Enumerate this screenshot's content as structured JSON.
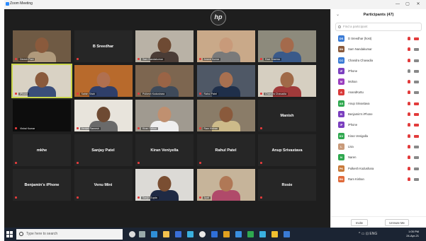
{
  "window": {
    "title": "Zoom Meeting",
    "minimize": "—",
    "maximize": "▢",
    "close": "✕"
  },
  "gallery": {
    "overlay_logo": "hp",
    "tiles": [
      {
        "label": "Dinesh Pani",
        "kind": "video",
        "bg": "#6f5a44",
        "skin": "#8a5a3c",
        "shirt": "#b09a7c"
      },
      {
        "label": "",
        "name": "B Sreedhar",
        "kind": "name"
      },
      {
        "label": "Sam Nandakumar",
        "kind": "video",
        "bg": "#b9b2a6",
        "skin": "#6e4a33",
        "shirt": "#4a3c36"
      },
      {
        "label": "Anand Kumar",
        "kind": "video",
        "bg": "#c9a989",
        "skin": "#c89a7a",
        "shirt": "#7a7a7a"
      },
      {
        "label": "Ravi Sharma",
        "kind": "video",
        "bg": "#8d8a7c",
        "skin": "#a46a4c",
        "shirt": "#3a5a8a"
      },
      {
        "label": "iPhone",
        "kind": "video",
        "bg": "#d9d2c4",
        "skin": "#8a5a3c",
        "shirt": "#3b4e7a"
      },
      {
        "label": "Satish Shah",
        "kind": "video",
        "bg": "#b86a2c",
        "skin": "#b07050",
        "shirt": "#2f3f6a"
      },
      {
        "label": "Pulkesh Kodushara",
        "kind": "video",
        "bg": "#7d6650",
        "skin": "#9a6446",
        "shirt": "#3e4a5a"
      },
      {
        "label": "Rahul Patel",
        "kind": "video",
        "bg": "#4f5866",
        "skin": "#a87050",
        "shirt": "#1f2f4a"
      },
      {
        "label": "Chandra Chavadia",
        "kind": "video",
        "bg": "#d6cfc1",
        "skin": "#a06a48",
        "shirt": "#a03a3a"
      },
      {
        "label": "Vishal Kumar",
        "kind": "dark"
      },
      {
        "label": "Venkat Ramesh",
        "kind": "video",
        "bg": "#e8e4dc",
        "skin": "#6e4a33",
        "shirt": "#6a6a6a"
      },
      {
        "label": "Kiran Sahoo",
        "kind": "video",
        "bg": "#a09a90",
        "skin": "#c09070",
        "shirt": "#efefef"
      },
      {
        "label": "Ram Kishan",
        "kind": "video",
        "bg": "#8a7c68",
        "skin": "#8a5a3c",
        "shirt": "#cdbb8a"
      },
      {
        "label": "",
        "name": "Manish",
        "kind": "name"
      },
      {
        "label": "",
        "name": "mkhe",
        "kind": "name"
      },
      {
        "label": "",
        "name": "Sanjay Patel",
        "kind": "name"
      },
      {
        "label": "",
        "name": "Kiran Veniyella",
        "kind": "name"
      },
      {
        "label": "",
        "name": "Rahul Patel",
        "kind": "name"
      },
      {
        "label": "",
        "name": "Anup Srivastava",
        "kind": "name"
      },
      {
        "label": "",
        "name": "Benjamin's iPhone",
        "kind": "name"
      },
      {
        "label": "",
        "name": "Venu Mini",
        "kind": "name"
      },
      {
        "label": "Sanjiv Gupta",
        "kind": "video",
        "bg": "#dcdad6",
        "skin": "#7a4e32",
        "shirt": "#1f2a44"
      },
      {
        "label": "Jyoti",
        "kind": "video",
        "bg": "#c6b49a",
        "skin": "#b07856",
        "shirt": "#b04a6a"
      },
      {
        "label": "",
        "name": "Rosie",
        "kind": "name"
      }
    ]
  },
  "participants": {
    "title": "Participants (47)",
    "collapse_icon": "chevron-icon",
    "search_placeholder": "Find a participant",
    "items": [
      {
        "initials": "DS",
        "color": "#3a7bd5",
        "name": "D Sreedhar (host)",
        "mic": "muted",
        "cam": "off"
      },
      {
        "initials": "SN",
        "color": "#8a5a3c",
        "name": "Sam Nandakumar",
        "mic": "muted",
        "cam": "on"
      },
      {
        "initials": "CC",
        "color": "#3a7bd5",
        "name": "Chandra Chavadia",
        "mic": "muted",
        "cam": "on"
      },
      {
        "initials": "iP",
        "color": "#7b3fbf",
        "name": "iPhone",
        "mic": "on",
        "cam": "on"
      },
      {
        "initials": "M",
        "color": "#9b3fbf",
        "name": "Mohan",
        "mic": "muted",
        "cam": "on"
      },
      {
        "initials": "A",
        "color": "#d93a3a",
        "name": "AnandKuttu",
        "mic": "muted",
        "cam": "on"
      },
      {
        "initials": "AS",
        "color": "#2fa84f",
        "name": "Anup Srivastava",
        "mic": "muted",
        "cam": "off"
      },
      {
        "initials": "B",
        "color": "#7b3fbf",
        "name": "Benjamin's iPhone",
        "mic": "muted",
        "cam": "off"
      },
      {
        "initials": "iP",
        "color": "#7b3fbf",
        "name": "iPhone",
        "mic": "muted",
        "cam": "off"
      },
      {
        "initials": "KV",
        "color": "#2fa84f",
        "name": "Kiran Venigalla",
        "mic": "muted",
        "cam": "off"
      },
      {
        "initials": "L",
        "color": "#c89a7a",
        "name": "Lisa",
        "mic": "muted",
        "cam": "on"
      },
      {
        "initials": "N",
        "color": "#2fa84f",
        "name": "Naren",
        "mic": "muted",
        "cam": "on"
      },
      {
        "initials": "PK",
        "color": "#c87a3a",
        "name": "Pulkesh Kodushara",
        "mic": "muted",
        "cam": "on"
      },
      {
        "initials": "RK",
        "color": "#e06a3a",
        "name": "Ram Kishan",
        "mic": "muted",
        "cam": "on"
      }
    ],
    "invite_label": "Invite",
    "unmute_label": "Unmute Me"
  },
  "taskbar": {
    "search_placeholder": "Type here to search",
    "time": "1:05 PM",
    "date": "24-Apr-21",
    "tray": "^ ▭ ⊡ ENG"
  }
}
